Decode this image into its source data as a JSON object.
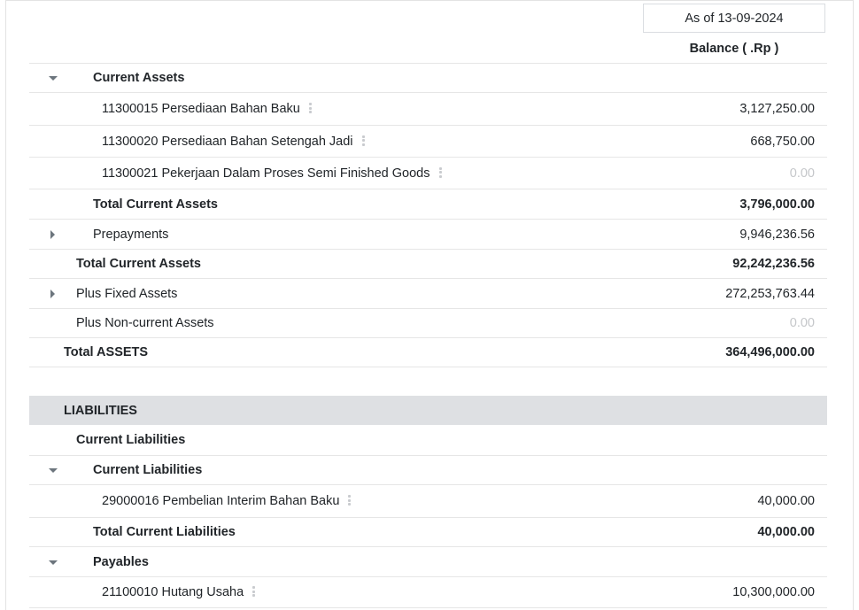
{
  "header": {
    "date_label": "As of 13-09-2024",
    "column_label": "Balance ( .Rp )"
  },
  "assets": {
    "current_assets_group": {
      "label": "Current Assets",
      "lines": [
        {
          "label": "11300015 Persediaan Bahan Baku",
          "amount": "3,127,250.00"
        },
        {
          "label": "11300020 Persediaan Bahan Setengah Jadi",
          "amount": "668,750.00"
        },
        {
          "label": "11300021 Pekerjaan Dalam Proses Semi Finished Goods",
          "amount": "0.00"
        }
      ],
      "total_label": "Total Current Assets",
      "total_amount": "3,796,000.00"
    },
    "prepayments": {
      "label": "Prepayments",
      "amount": "9,946,236.56"
    },
    "total_current_assets": {
      "label": "Total Current Assets",
      "amount": "92,242,236.56"
    },
    "fixed_assets": {
      "label": "Plus Fixed Assets",
      "amount": "272,253,763.44"
    },
    "non_current_assets": {
      "label": "Plus Non-current Assets",
      "amount": "0.00"
    },
    "total_assets": {
      "label": "Total ASSETS",
      "amount": "364,496,000.00"
    }
  },
  "liabilities": {
    "section_label": "LIABILITIES",
    "current_liabilities_header": "Current Liabilities",
    "current_liabilities_group": {
      "label": "Current Liabilities",
      "lines": [
        {
          "label": "29000016 Pembelian Interim Bahan Baku",
          "amount": "40,000.00"
        }
      ],
      "total_label": "Total Current Liabilities",
      "total_amount": "40,000.00"
    },
    "payables_group": {
      "label": "Payables",
      "lines": [
        {
          "label": "21100010 Hutang Usaha",
          "amount": "10,300,000.00"
        }
      ]
    }
  },
  "icons": {
    "expanded": "caret-down-icon",
    "collapsed": "caret-right-icon",
    "line_menu": "vertical-dots-icon"
  }
}
